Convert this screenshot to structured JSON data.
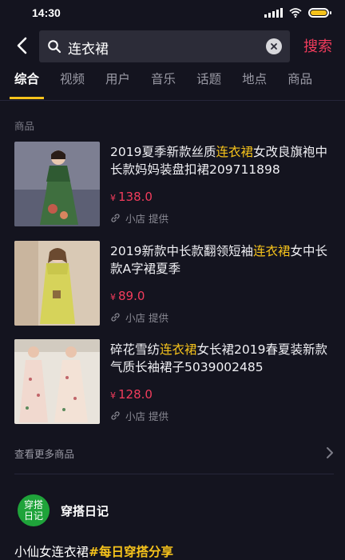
{
  "status": {
    "time": "14:30"
  },
  "search": {
    "query": "连衣裙",
    "submit_label": "搜索"
  },
  "tabs": [
    {
      "label": "综合",
      "active": true
    },
    {
      "label": "视频"
    },
    {
      "label": "用户"
    },
    {
      "label": "音乐"
    },
    {
      "label": "话题"
    },
    {
      "label": "地点"
    },
    {
      "label": "商品"
    }
  ],
  "products_section": {
    "label": "商品",
    "items": [
      {
        "title_pre": "2019夏季新款丝质",
        "title_hl": "连衣裙",
        "title_post": "女改良旗袍中长款妈妈装盘扣裙209711898",
        "currency": "¥",
        "price": "138.0",
        "source": "小店 提供"
      },
      {
        "title_pre": "2019新款中长款翻领短袖",
        "title_hl": "连衣裙",
        "title_post": "女中长款A字裙夏季",
        "currency": "¥",
        "price": "89.0",
        "source": "小店 提供"
      },
      {
        "title_pre": "碎花雪纺",
        "title_hl": "连衣裙",
        "title_post": "女长裙2019春夏装新款气质长袖裙子5039002485",
        "currency": "¥",
        "price": "128.0",
        "source": "小店 提供"
      }
    ],
    "more_label": "查看更多商品"
  },
  "account": {
    "avatar_line1": "穿搭",
    "avatar_line2": "日记",
    "name": "穿搭日记"
  },
  "video": {
    "title": "小仙女连衣裙",
    "tag": "#每日穿搭分享"
  },
  "colors": {
    "accent": "#f5c21b",
    "price": "#f23c5c",
    "background": "#14141f"
  }
}
